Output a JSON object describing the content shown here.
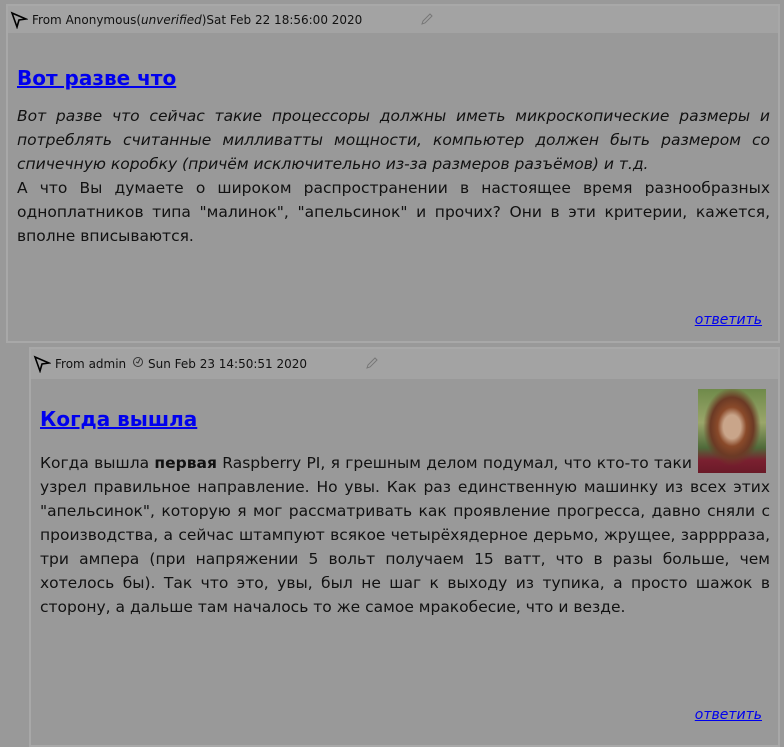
{
  "posts": [
    {
      "from_prefix": "From ",
      "author": "Anonymous",
      "unverified_open": " (",
      "unverified": "unverified",
      "unverified_close": ")",
      "date": " Sat Feb 22 18:56:00 2020",
      "title": "Вот разве что",
      "quote": "Вот разве что сейчас такие процессоры должны иметь микроскопические размеры и потреблять считанные милливатты мощности, компьютер должен быть размером со спичечную коробку (причём исключительно из-за размеров разъёмов) и т.д.",
      "text": "А что Вы думаете о широком распространении в настоящее время разнообразных одноплатников типа \"малинок\", \"апельсинок\" и прочих? Они в эти критерии, кажется, вполне вписываются.",
      "reply": "ответить"
    },
    {
      "from_prefix": "From ",
      "author": "admin",
      "date": "Sun Feb 23 14:50:51 2020",
      "title": "Когда вышла",
      "text_a": "Когда вышла ",
      "text_bold": "первая",
      "text_b": " Raspberry PI, я грешным делом подумал, что кто-то таки узрел правильное направление. Но увы. Как раз единственную машинку из всех этих \"апельсинок\", которую я мог рассматривать как проявление прогресса, давно сняли с производства, а сейчас штампуют всякое четырёхядерное дерьмо, жрущее, заррррaза, три ампера (при напряжении 5 вольт получаем 15 ватт, что в разы больше, чем хотелось бы). Так что это, увы, был не шаг к выходу из тупика, а просто шажок в сторону, а дальше там началось то же самое мракобесие, что и везде.",
      "reply": "ответить"
    }
  ]
}
